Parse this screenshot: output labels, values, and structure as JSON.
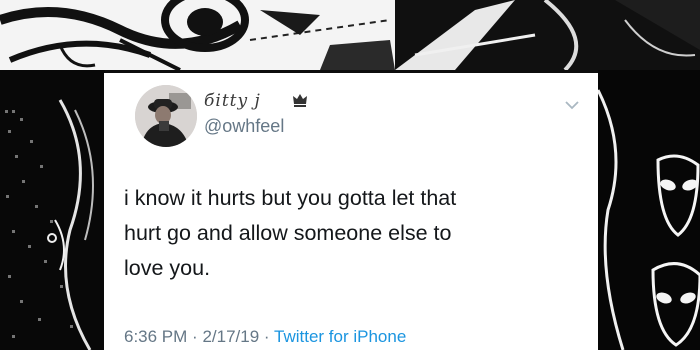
{
  "tweet": {
    "display_name": "бitty j",
    "handle": "@owhfeel",
    "text_lines": [
      "i know it hurts but you gotta let that",
      "hurt go and allow someone else to",
      "love you."
    ],
    "time": "6:36 PM",
    "separator": "·",
    "date": "2/17/19",
    "source": "Twitter for iPhone"
  },
  "icons": {
    "badge": "crown-icon",
    "menu": "chevron-down-icon"
  },
  "colors": {
    "link": "#1b95e0",
    "secondary_text": "#657786",
    "primary_text": "#14171a"
  }
}
